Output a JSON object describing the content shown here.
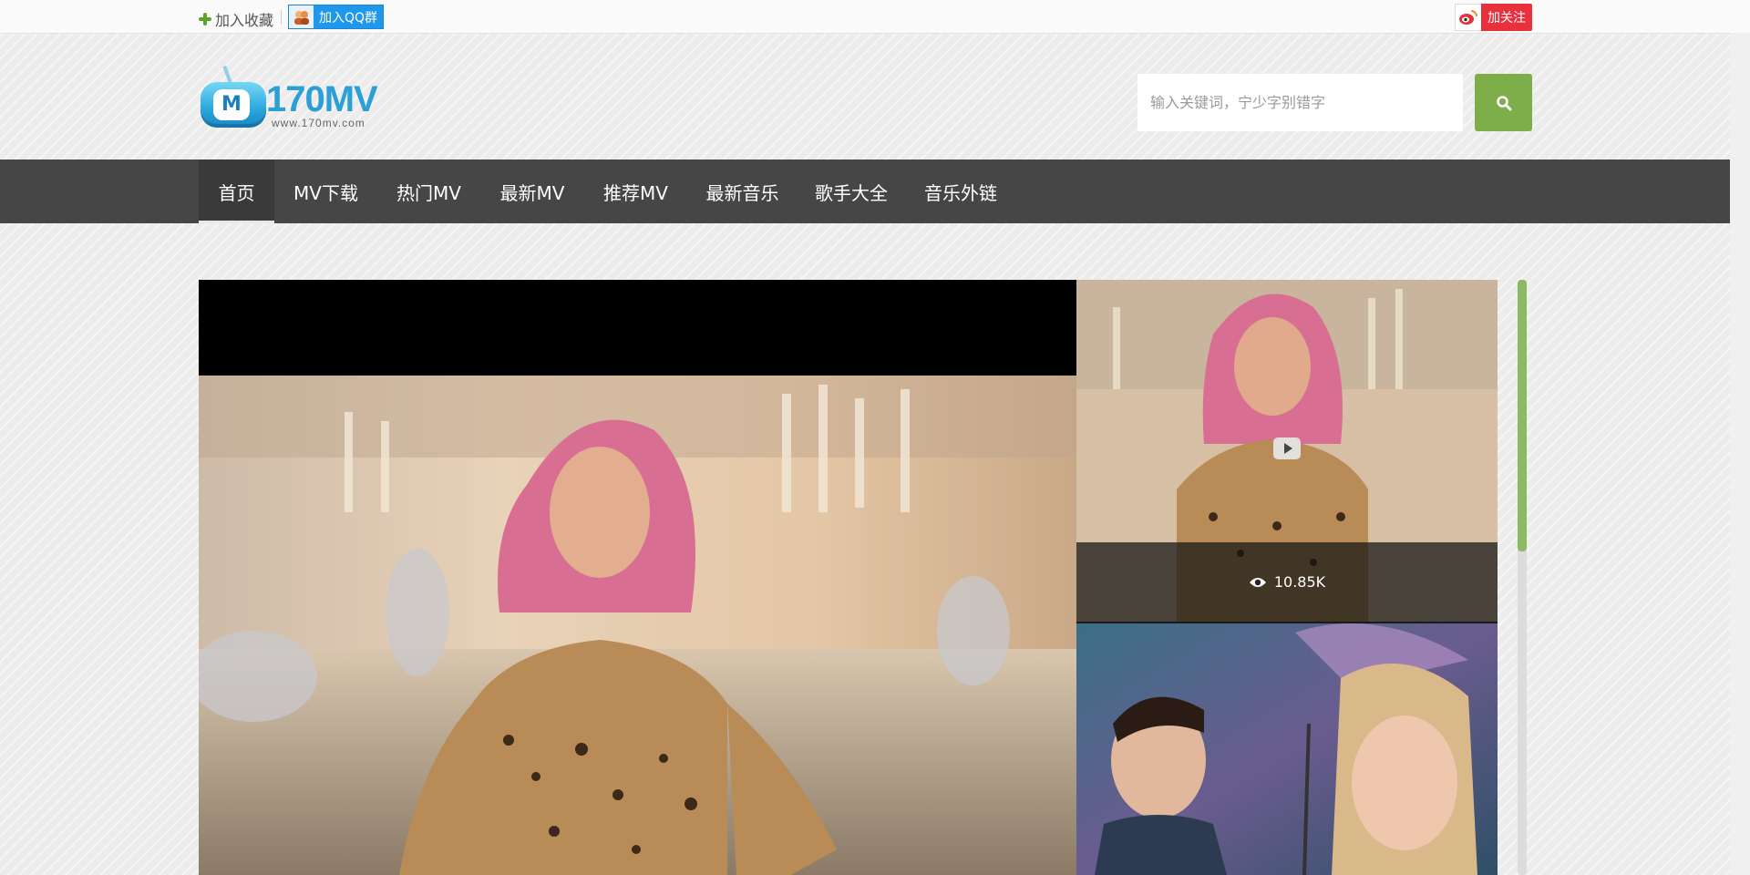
{
  "topbar": {
    "favorite_label": "加入收藏",
    "qq_group_label": "加入QQ群",
    "weibo_follow_label": "加关注"
  },
  "logo": {
    "brand": "170MV",
    "screen_letter": "M",
    "url": "www.170mv.com"
  },
  "search": {
    "placeholder": "输入关键词，宁少字别错字",
    "value": ""
  },
  "nav": {
    "items": [
      {
        "label": "首页",
        "active": true
      },
      {
        "label": "MV下载",
        "active": false
      },
      {
        "label": "热门MV",
        "active": false
      },
      {
        "label": "最新MV",
        "active": false
      },
      {
        "label": "推荐MV",
        "active": false
      },
      {
        "label": "最新音乐",
        "active": false
      },
      {
        "label": "歌手大全",
        "active": false
      },
      {
        "label": "音乐外链",
        "active": false
      }
    ]
  },
  "featured": {
    "side_cards": [
      {
        "views": "10.85K"
      }
    ]
  },
  "colors": {
    "nav_bg": "#464646",
    "search_button": "#7eae4a",
    "scroll_thumb": "#8cba62",
    "weibo_red": "#e8313c",
    "qq_blue": "#1f97ea"
  },
  "icons": [
    "plus-icon",
    "qq-icon",
    "weibo-icon",
    "search-icon",
    "play-icon",
    "eye-icon"
  ]
}
